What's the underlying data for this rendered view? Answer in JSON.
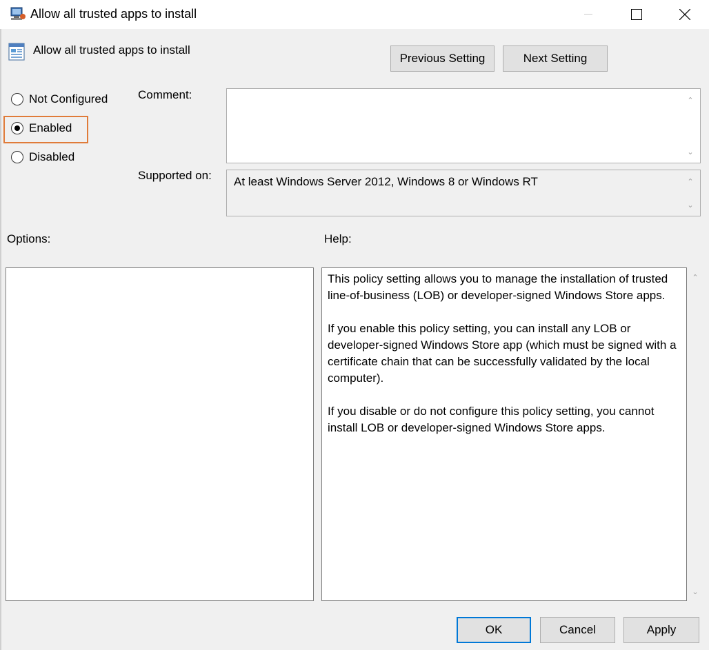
{
  "window": {
    "title": "Allow all trusted apps to install",
    "icon": "group-policy-icon",
    "controls": {
      "minimize": "—",
      "maximize": "☐",
      "close": "✕"
    }
  },
  "header": {
    "policy_name": "Allow all trusted apps to install",
    "policy_icon": "policy-setting-icon",
    "previous_label": "Previous Setting",
    "next_label": "Next Setting"
  },
  "state": {
    "options": [
      {
        "label": "Not Configured",
        "checked": false
      },
      {
        "label": "Enabled",
        "checked": true
      },
      {
        "label": "Disabled",
        "checked": false
      }
    ],
    "highlight_color": "#e07b39"
  },
  "comment": {
    "label": "Comment:",
    "value": ""
  },
  "supported": {
    "label": "Supported on:",
    "value": "At least Windows Server 2012, Windows 8 or Windows RT"
  },
  "options_panel": {
    "label": "Options:"
  },
  "help_panel": {
    "label": "Help:",
    "paragraphs": [
      "This policy setting allows you to manage the installation of trusted line-of-business (LOB) or developer-signed Windows Store apps.",
      "If you enable this policy setting, you can install any LOB or developer-signed Windows Store app (which must be signed with a certificate chain that can be successfully validated by the local computer).",
      "If you disable or do not configure this policy setting, you cannot install LOB or developer-signed Windows Store apps."
    ]
  },
  "footer": {
    "ok_label": "OK",
    "cancel_label": "Cancel",
    "apply_label": "Apply",
    "accent_color": "#0078d7"
  }
}
